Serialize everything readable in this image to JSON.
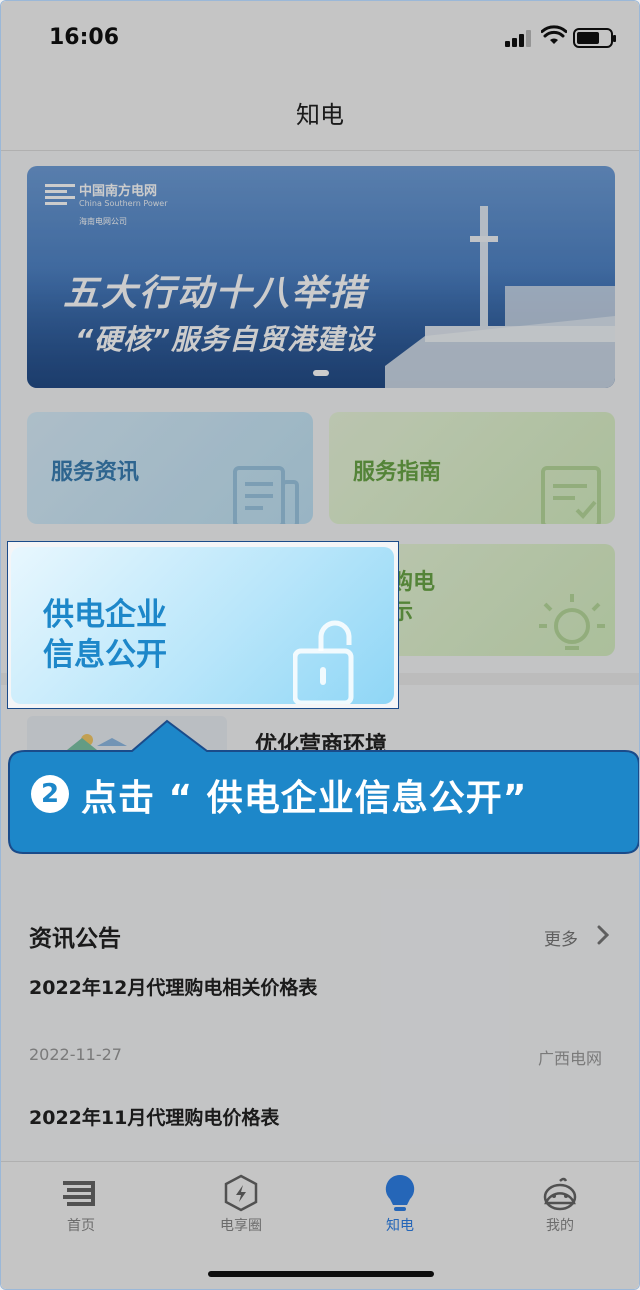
{
  "status": {
    "time": "16:06"
  },
  "nav": {
    "title": "知电"
  },
  "banner": {
    "logo_cn": "中国南方电网",
    "logo_en": "China Southern Power",
    "logo_sub": "海南电网公司",
    "headline": "五大行动十八举措",
    "subheadline": "“硬核”服务自贸港建设"
  },
  "cards": {
    "service_news": "服务资讯",
    "service_guide": "服务指南",
    "supply_info_line1": "供电企业",
    "supply_info_line2": "信息公开",
    "proxy_line1": "理购电",
    "proxy_line2": "公示"
  },
  "promo": {
    "title": "优化营商环境"
  },
  "news": {
    "heading": "资讯公告",
    "more": "更多",
    "items": [
      {
        "title": "2022年12月代理购电相关价格表"
      },
      {
        "title": "2022年11月代理购电价格表"
      }
    ],
    "meta_date": "2022-11-27",
    "meta_source": "广西电网"
  },
  "tabs": [
    {
      "label": "首页",
      "icon": "grid-logo-icon"
    },
    {
      "label": "电享圈",
      "icon": "lightning-hexagon-icon"
    },
    {
      "label": "知电",
      "icon": "lightbulb-icon"
    },
    {
      "label": "我的",
      "icon": "face-icon"
    }
  ],
  "callout": {
    "number": "2",
    "text": "点击 “ 供电企业信息公开”"
  },
  "colors": {
    "accent": "#1d87c9",
    "tab_active": "#2f80e7",
    "callout_bg": "#1d87c9"
  }
}
